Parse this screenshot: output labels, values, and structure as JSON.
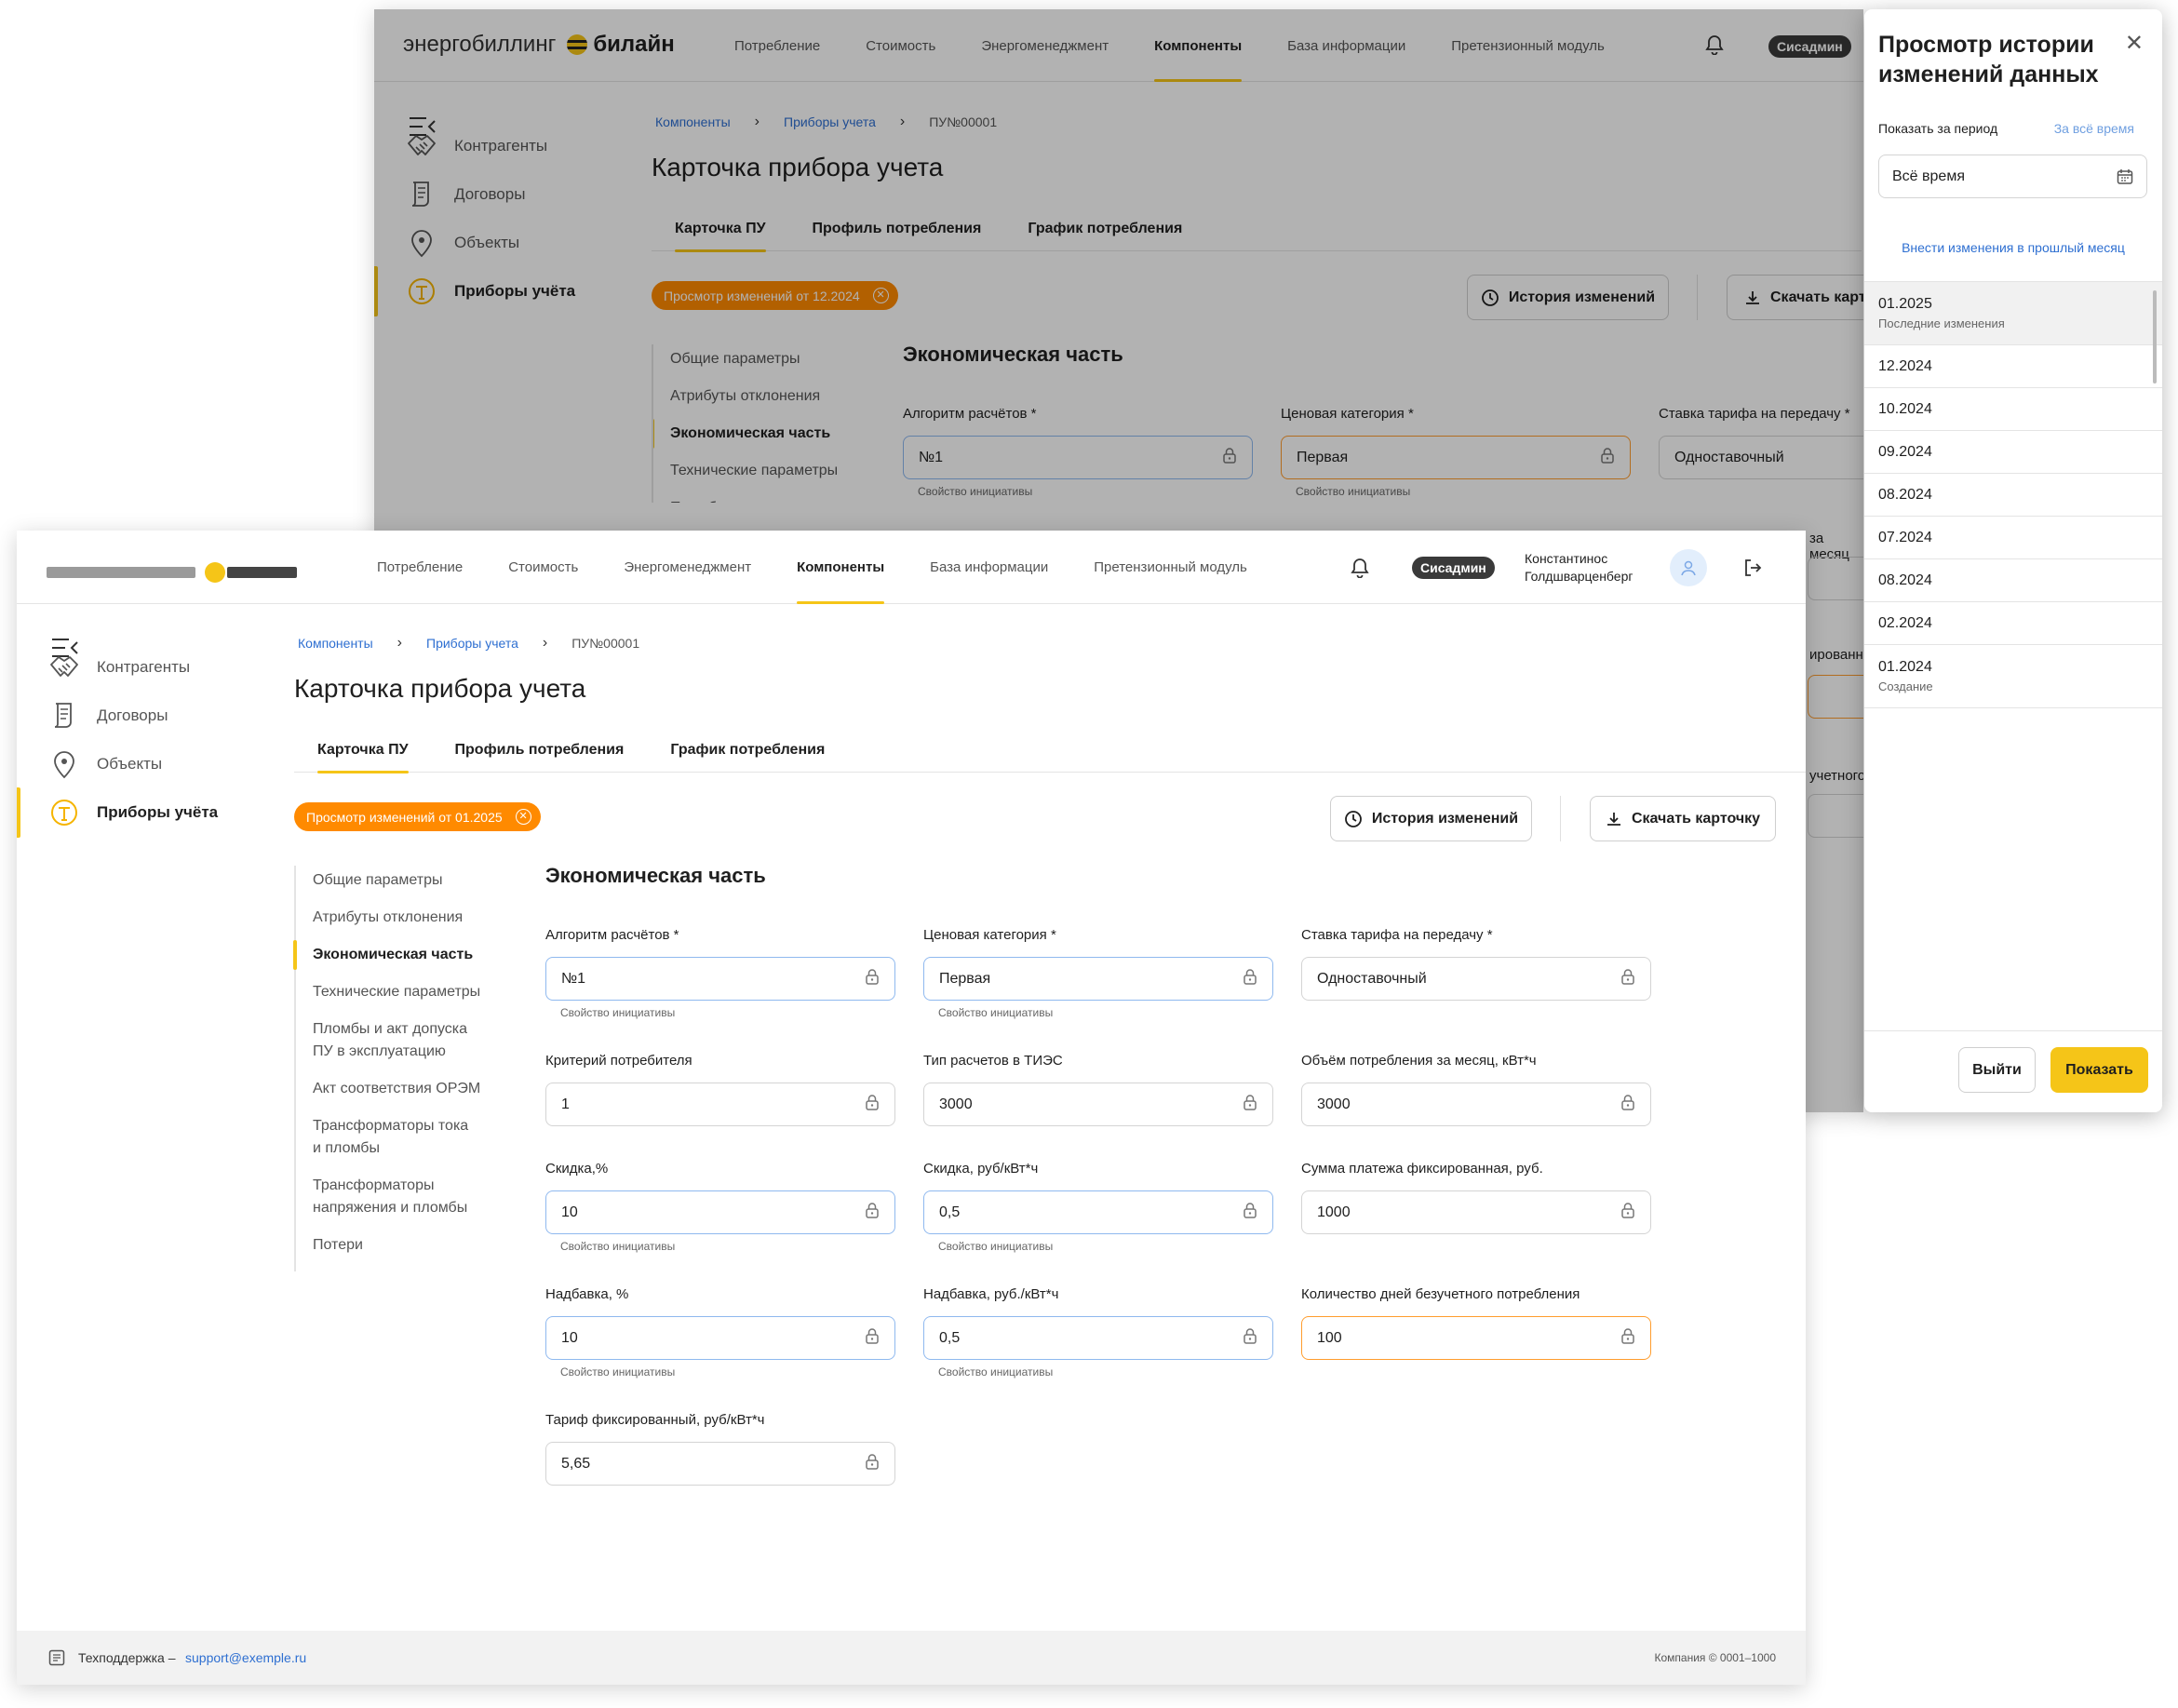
{
  "app": {
    "brand_text": "энергобиллинг",
    "brand_partner": "билайн",
    "nav": [
      "Потребление",
      "Стоимость",
      "Энергоменеджмент",
      "Компоненты",
      "База информации",
      "Претензионный модуль"
    ],
    "nav_active": 3,
    "role_badge": "Сисадмин",
    "user_name_line1": "Константинос",
    "user_name_line2": "Голдшварценберг"
  },
  "sidebar": {
    "items": [
      {
        "label": "Контрагенты",
        "icon": "handshake-icon"
      },
      {
        "label": "Договоры",
        "icon": "document-icon"
      },
      {
        "label": "Объекты",
        "icon": "location-pin-icon"
      },
      {
        "label": "Приборы учёта",
        "icon": "meter-icon"
      }
    ],
    "active": 3
  },
  "breadcrumb": {
    "items": [
      "Компоненты",
      "Приборы учета"
    ],
    "current": "ПУ№00001"
  },
  "page_title": "Карточка прибора учета",
  "tabs": [
    "Карточка ПУ",
    "Профиль потребления",
    "График потребления"
  ],
  "back": {
    "chip": "Просмотр изменений от 12.2024",
    "history_button": "История изменений",
    "download_button": "Скачать карт",
    "fields": [
      {
        "label": "Алгоритм расчётов *",
        "value": "№1",
        "hint": "Свойство инициативы"
      },
      {
        "label": "Ценовая категория *",
        "value": "Первая",
        "hint": "Свойство инициативы"
      },
      {
        "label": "Ставка тарифа на передачу *",
        "value": "Одноставочный"
      }
    ],
    "subnav": [
      "Общие параметры",
      "Атрибуты отклонения",
      "Экономическая часть",
      "Технические параметры",
      "Пломбы и акт допуска",
      "ПУ в эксплуатацию"
    ],
    "partial_labels": [
      "за месяц",
      "ированн",
      "учетного"
    ]
  },
  "front": {
    "chip": "Просмотр изменений от 01.2025",
    "history_button": "История изменений",
    "download_button": "Скачать карточку",
    "subnav": [
      [
        "Общие параметры"
      ],
      [
        "Атрибуты отклонения"
      ],
      [
        "Экономическая часть"
      ],
      [
        "Технические параметры"
      ],
      [
        "Пломбы и акт допуска",
        "ПУ в эксплуатацию"
      ],
      [
        "Акт соответствия ОРЭМ"
      ],
      [
        "Трансформаторы тока",
        "и пломбы"
      ],
      [
        "Трансформаторы",
        "напряжения и пломбы"
      ],
      [
        "Потери"
      ]
    ],
    "subnav_active": 2,
    "section_title": "Экономическая часть",
    "fields": [
      [
        {
          "label": "Алгоритм расчётов *",
          "value": "№1",
          "hint": "Свойство инициативы",
          "state": "init"
        },
        {
          "label": "Ценовая категория *",
          "value": "Первая",
          "hint": "Свойство инициативы",
          "state": "init"
        },
        {
          "label": "Ставка тарифа на передачу *",
          "value": "Одноставочный",
          "hint": "",
          "state": ""
        }
      ],
      [
        {
          "label": "Критерий потребителя",
          "value": "1",
          "hint": "",
          "state": ""
        },
        {
          "label": "Тип расчетов в ТИЭС",
          "value": "3000",
          "hint": "",
          "state": ""
        },
        {
          "label": "Объём потребления за месяц, кВт*ч",
          "value": "3000",
          "hint": "",
          "state": ""
        }
      ],
      [
        {
          "label": "Скидка,%",
          "value": "10",
          "hint": "Свойство инициативы",
          "state": "init"
        },
        {
          "label": "Скидка, руб/кВт*ч",
          "value": "0,5",
          "hint": "Свойство инициативы",
          "state": "init"
        },
        {
          "label": "Сумма платежа фиксированная, руб.",
          "value": "1000",
          "hint": "",
          "state": ""
        }
      ],
      [
        {
          "label": "Надбавка, %",
          "value": "10",
          "hint": "Свойство инициативы",
          "state": "init"
        },
        {
          "label": "Надбавка, руб./кВт*ч",
          "value": "0,5",
          "hint": "Свойство инициативы",
          "state": "init"
        },
        {
          "label": "Количество дней безучетного потребления",
          "value": "100",
          "hint": "",
          "state": "chg"
        }
      ],
      [
        {
          "label": "Тариф фиксированный, руб/кВт*ч",
          "value": "5,65",
          "hint": "",
          "state": ""
        }
      ]
    ],
    "footer_support": "Техподдержка –",
    "footer_email": "support@exemple.ru",
    "footer_copyright": "Компания © 0001–1000"
  },
  "drawer": {
    "title_line1": "Просмотр истории",
    "title_line2": "изменений данных",
    "period_label": "Показать за период",
    "period_all": "За всё время",
    "select_value": "Всё время",
    "past_link": "Внести изменения в прошлый месяц",
    "history": [
      {
        "date": "01.2025",
        "sub": "Последние изменения"
      },
      {
        "date": "12.2024",
        "sub": ""
      },
      {
        "date": "10.2024",
        "sub": ""
      },
      {
        "date": "09.2024",
        "sub": ""
      },
      {
        "date": "08.2024",
        "sub": ""
      },
      {
        "date": "07.2024",
        "sub": ""
      },
      {
        "date": "08.2024",
        "sub": ""
      },
      {
        "date": "02.2024",
        "sub": ""
      },
      {
        "date": "01.2024",
        "sub": "Создание"
      }
    ],
    "selected": 0,
    "exit_button": "Выйти",
    "show_button": "Показать"
  },
  "colors": {
    "accent": "#f5c518",
    "chip": "#ff8a00",
    "link": "#2e6fd1",
    "init_border": "#8fb9ef",
    "changed_border": "#ff9d2e"
  }
}
